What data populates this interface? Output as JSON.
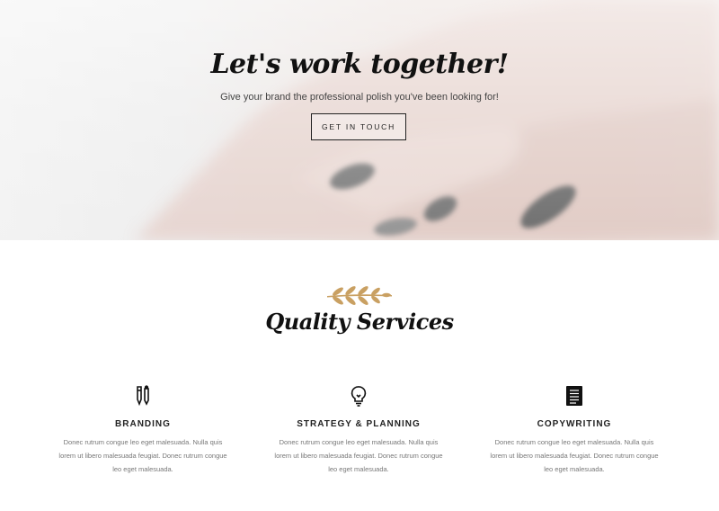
{
  "hero": {
    "title": "Let's work together!",
    "subtitle": "Give your brand the professional polish you've been looking for!",
    "cta_label": "GET IN TOUCH"
  },
  "services_section": {
    "title": "Quality Services",
    "ornament_icon": "laurel-branch-icon",
    "accent_color": "#c9a062",
    "items": [
      {
        "icon": "pen-pencil-icon",
        "title": "BRANDING",
        "text": "Donec rutrum congue leo eget malesuada. Nulla quis lorem ut libero malesuada feugiat. Donec rutrum congue leo eget malesuada."
      },
      {
        "icon": "lightbulb-icon",
        "title": "STRATEGY & PLANNING",
        "text": "Donec rutrum congue leo eget malesuada. Nulla quis lorem ut libero malesuada feugiat. Donec rutrum congue leo eget malesuada."
      },
      {
        "icon": "document-icon",
        "title": "COPYWRITING",
        "text": "Donec rutrum congue leo eget malesuada. Nulla quis lorem ut libero malesuada feugiat. Donec rutrum congue leo eget malesuada."
      }
    ]
  }
}
